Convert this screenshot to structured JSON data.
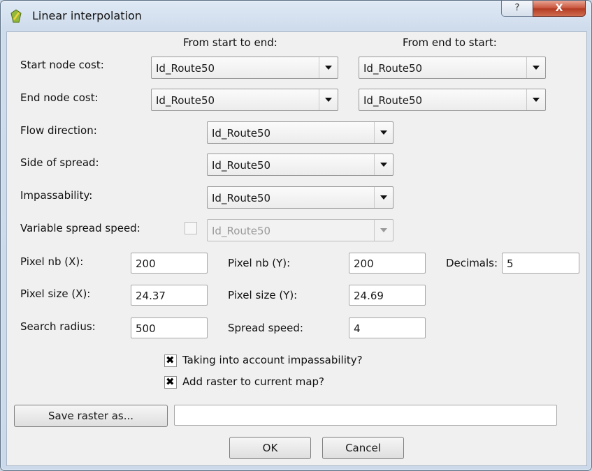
{
  "window": {
    "title": "Linear interpolation",
    "help_label": "?",
    "close_label": "X"
  },
  "headers": {
    "start_to_end": "From start to end:",
    "end_to_start": "From end to start:"
  },
  "costs": {
    "start_node_label": "Start node cost:",
    "end_node_label": "End node cost:",
    "start_node_start_to_end": "Id_Route50",
    "start_node_end_to_start": "Id_Route50",
    "end_node_start_to_end": "Id_Route50",
    "end_node_end_to_start": "Id_Route50"
  },
  "fields": {
    "flow_direction_label": "Flow direction:",
    "flow_direction_value": "Id_Route50",
    "side_of_spread_label": "Side of spread:",
    "side_of_spread_value": "Id_Route50",
    "impassability_label": "Impassability:",
    "impassability_value": "Id_Route50",
    "variable_speed_label": "Variable spread speed:",
    "variable_speed_value": "Id_Route50"
  },
  "params": {
    "pixel_nb_x_label": "Pixel nb (X):",
    "pixel_nb_x": "200",
    "pixel_nb_y_label": "Pixel nb (Y):",
    "pixel_nb_y": "200",
    "decimals_label": "Decimals:",
    "decimals": "5",
    "pixel_size_x_label": "Pixel size (X):",
    "pixel_size_x": "24.37",
    "pixel_size_y_label": "Pixel size (Y):",
    "pixel_size_y": "24.69",
    "search_radius_label": "Search radius:",
    "search_radius": "500",
    "spread_speed_label": "Spread speed:",
    "spread_speed": "4"
  },
  "options": {
    "impassability_label": "Taking into account impassability?",
    "add_raster_label": "Add raster to current map?"
  },
  "save": {
    "button_label": "Save raster as...",
    "path_value": ""
  },
  "actions": {
    "ok": "OK",
    "cancel": "Cancel"
  }
}
